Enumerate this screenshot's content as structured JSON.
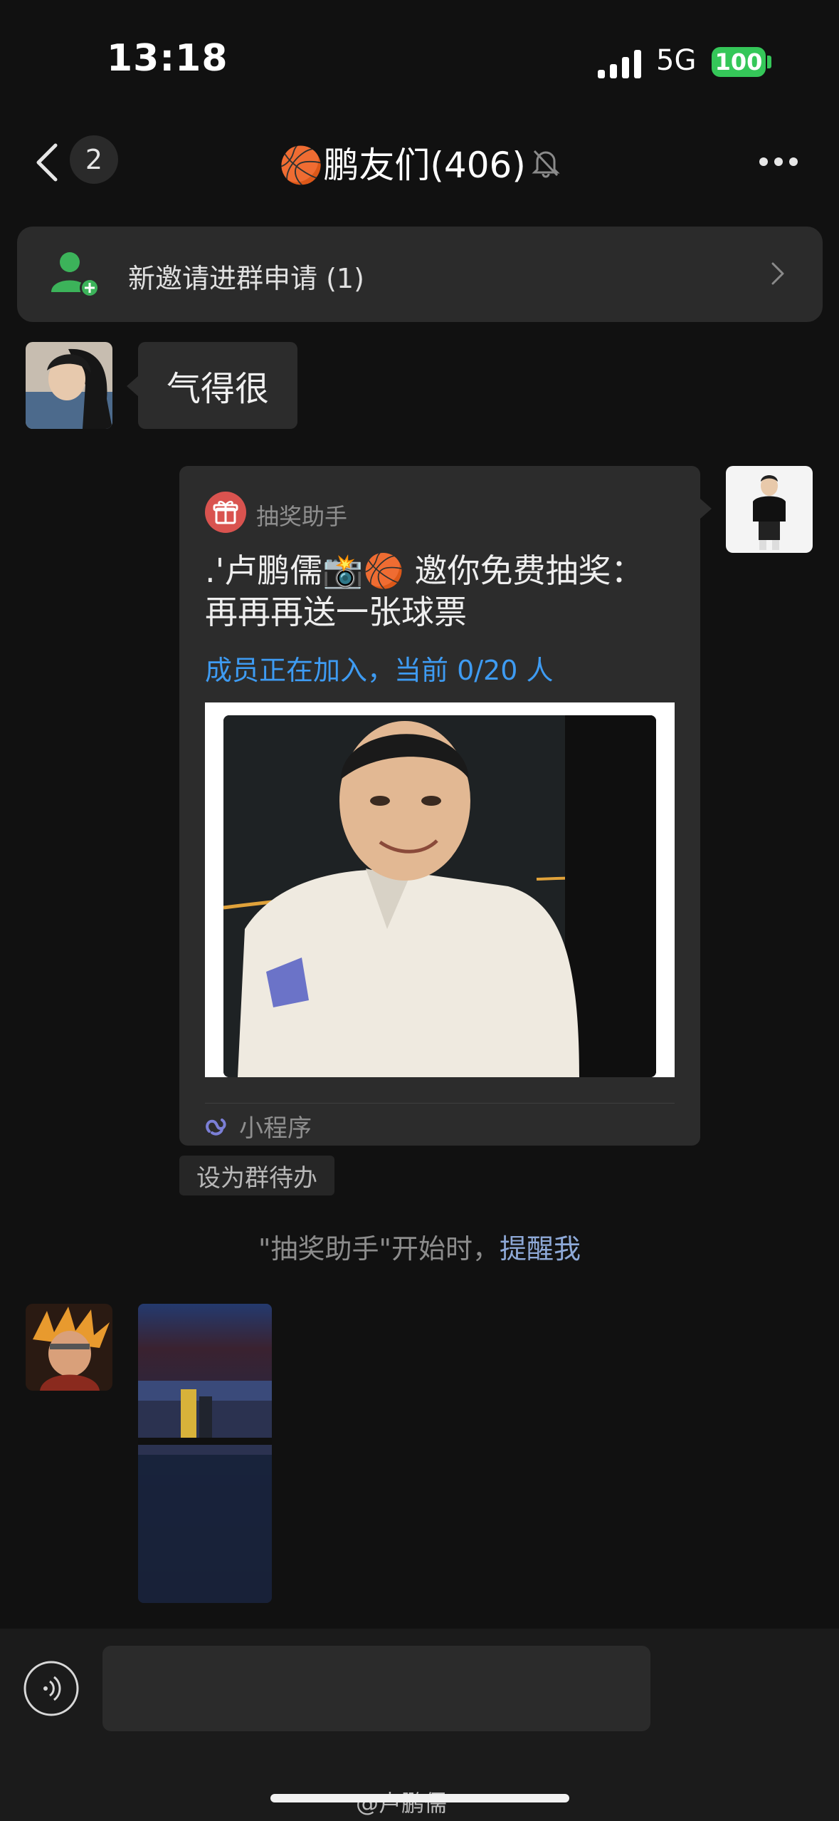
{
  "status_bar": {
    "time": "13:18",
    "network": "5G",
    "battery": "100"
  },
  "nav": {
    "unread_count": "2",
    "group_name": "🏀鹏友们(406)"
  },
  "invite_banner": {
    "text": "新邀请进群申请 (1)"
  },
  "messages": {
    "first": {
      "text": "气得很"
    },
    "card": {
      "app_name": "抽奖助手",
      "title": ".'卢鹏儒📸🏀 邀你免费抽奖：再再再送一张球票",
      "status": "成员正在加入，当前 0/20 人",
      "mini_program_label": "小程序"
    },
    "set_todo": "设为群待办",
    "reminder": {
      "prefix": "\"抽奖助手\"开始时，",
      "link": "提醒我"
    }
  },
  "watermark": "@卢鹏儒",
  "colors": {
    "link_blue": "#3e9bf2",
    "battery_green": "#35c759",
    "background": "#111111",
    "bubble": "#2c2c2c"
  }
}
